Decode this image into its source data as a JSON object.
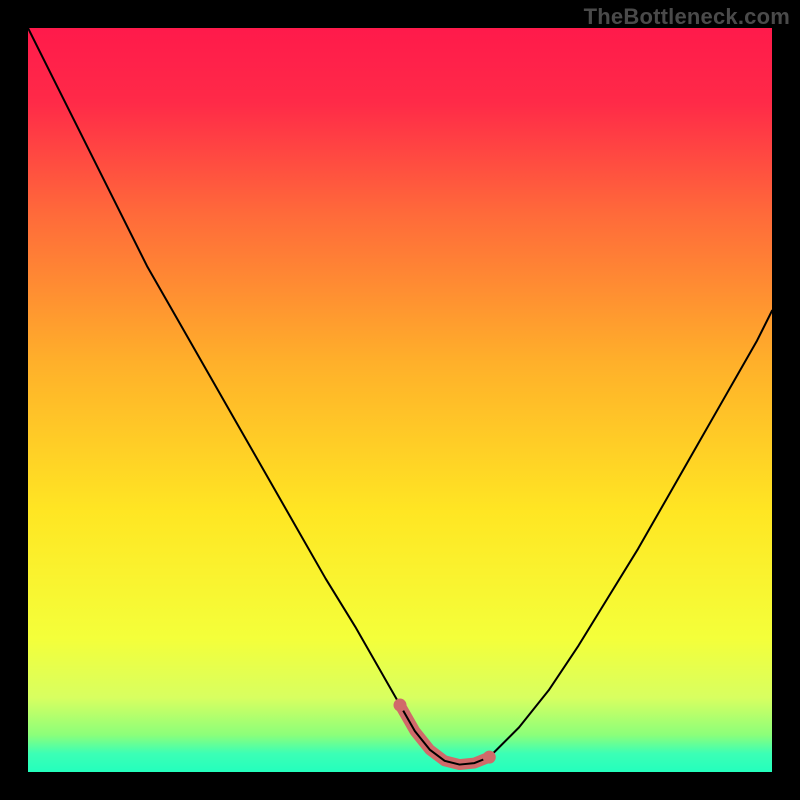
{
  "watermark": "TheBottleneck.com",
  "chart_data": {
    "type": "line",
    "title": "",
    "xlabel": "",
    "ylabel": "",
    "xlim": [
      0,
      100
    ],
    "ylim": [
      0,
      100
    ],
    "x": [
      0,
      4,
      8,
      12,
      16,
      20,
      24,
      28,
      32,
      36,
      40,
      44,
      48,
      50,
      52,
      54,
      56,
      58,
      60,
      62,
      66,
      70,
      74,
      78,
      82,
      86,
      90,
      94,
      98,
      100
    ],
    "values": [
      100,
      92,
      84,
      76,
      68,
      61,
      54,
      47,
      40,
      33,
      26,
      19.5,
      12.5,
      9,
      5.5,
      3,
      1.5,
      1,
      1.2,
      2,
      6,
      11,
      17,
      23.5,
      30,
      37,
      44,
      51,
      58,
      62
    ],
    "highlight_band": {
      "x_start": 50,
      "x_end": 62,
      "color": "#d06a6a"
    },
    "background_gradient": {
      "direction": "vertical",
      "stops": [
        {
          "offset": 0.0,
          "color": "#ff1a4b"
        },
        {
          "offset": 0.1,
          "color": "#ff2a48"
        },
        {
          "offset": 0.25,
          "color": "#ff6a3a"
        },
        {
          "offset": 0.45,
          "color": "#ffb02a"
        },
        {
          "offset": 0.65,
          "color": "#ffe623"
        },
        {
          "offset": 0.82,
          "color": "#f4ff3a"
        },
        {
          "offset": 0.9,
          "color": "#d8ff60"
        },
        {
          "offset": 0.95,
          "color": "#8cff7a"
        },
        {
          "offset": 0.975,
          "color": "#3cffb5"
        },
        {
          "offset": 1.0,
          "color": "#23ffbd"
        }
      ]
    },
    "line_color": "#000000",
    "line_width": 2
  }
}
